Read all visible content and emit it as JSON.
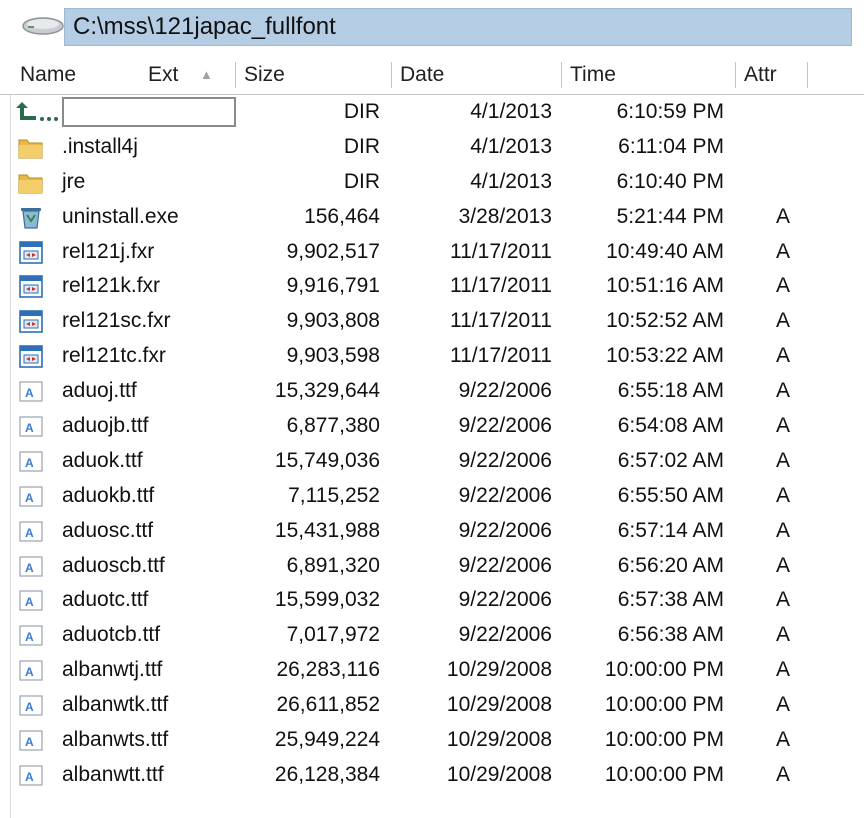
{
  "path": {
    "icon": "drive-icon",
    "value": "C:\\mss\\121japac_fullfont"
  },
  "columns": {
    "name": "Name",
    "ext": "Ext",
    "size": "Size",
    "date": "Date",
    "time": "Time",
    "attr": "Attr",
    "sort_indicator": "▲"
  },
  "up_row": {
    "icon": "up-folder-icon",
    "label": "",
    "size": "DIR",
    "date": "4/1/2013",
    "time": "6:10:59 PM",
    "attr": ""
  },
  "files": [
    {
      "icon": "folder-icon",
      "name": ".install4j",
      "size": "DIR",
      "date": "4/1/2013",
      "time": "6:11:04 PM",
      "attr": ""
    },
    {
      "icon": "folder-icon",
      "name": "jre",
      "size": "DIR",
      "date": "4/1/2013",
      "time": "6:10:40 PM",
      "attr": ""
    },
    {
      "icon": "uninstall-icon",
      "name": "uninstall.exe",
      "size": "156,464",
      "date": "3/28/2013",
      "time": "5:21:44 PM",
      "attr": "A"
    },
    {
      "icon": "fxr-file-icon",
      "name": "rel121j.fxr",
      "size": "9,902,517",
      "date": "11/17/2011",
      "time": "10:49:40 AM",
      "attr": "A"
    },
    {
      "icon": "fxr-file-icon",
      "name": "rel121k.fxr",
      "size": "9,916,791",
      "date": "11/17/2011",
      "time": "10:51:16 AM",
      "attr": "A"
    },
    {
      "icon": "fxr-file-icon",
      "name": "rel121sc.fxr",
      "size": "9,903,808",
      "date": "11/17/2011",
      "time": "10:52:52 AM",
      "attr": "A"
    },
    {
      "icon": "fxr-file-icon",
      "name": "rel121tc.fxr",
      "size": "9,903,598",
      "date": "11/17/2011",
      "time": "10:53:22 AM",
      "attr": "A"
    },
    {
      "icon": "font-file-icon",
      "name": "aduoj.ttf",
      "size": "15,329,644",
      "date": "9/22/2006",
      "time": "6:55:18 AM",
      "attr": "A"
    },
    {
      "icon": "font-file-icon",
      "name": "aduojb.ttf",
      "size": "6,877,380",
      "date": "9/22/2006",
      "time": "6:54:08 AM",
      "attr": "A"
    },
    {
      "icon": "font-file-icon",
      "name": "aduok.ttf",
      "size": "15,749,036",
      "date": "9/22/2006",
      "time": "6:57:02 AM",
      "attr": "A"
    },
    {
      "icon": "font-file-icon",
      "name": "aduokb.ttf",
      "size": "7,115,252",
      "date": "9/22/2006",
      "time": "6:55:50 AM",
      "attr": "A"
    },
    {
      "icon": "font-file-icon",
      "name": "aduosc.ttf",
      "size": "15,431,988",
      "date": "9/22/2006",
      "time": "6:57:14 AM",
      "attr": "A"
    },
    {
      "icon": "font-file-icon",
      "name": "aduoscb.ttf",
      "size": "6,891,320",
      "date": "9/22/2006",
      "time": "6:56:20 AM",
      "attr": "A"
    },
    {
      "icon": "font-file-icon",
      "name": "aduotc.ttf",
      "size": "15,599,032",
      "date": "9/22/2006",
      "time": "6:57:38 AM",
      "attr": "A"
    },
    {
      "icon": "font-file-icon",
      "name": "aduotcb.ttf",
      "size": "7,017,972",
      "date": "9/22/2006",
      "time": "6:56:38 AM",
      "attr": "A"
    },
    {
      "icon": "font-file-icon",
      "name": "albanwtj.ttf",
      "size": "26,283,116",
      "date": "10/29/2008",
      "time": "10:00:00 PM",
      "attr": "A"
    },
    {
      "icon": "font-file-icon",
      "name": "albanwtk.ttf",
      "size": "26,611,852",
      "date": "10/29/2008",
      "time": "10:00:00 PM",
      "attr": "A"
    },
    {
      "icon": "font-file-icon",
      "name": "albanwts.ttf",
      "size": "25,949,224",
      "date": "10/29/2008",
      "time": "10:00:00 PM",
      "attr": "A"
    },
    {
      "icon": "font-file-icon",
      "name": "albanwtt.ttf",
      "size": "26,128,384",
      "date": "10/29/2008",
      "time": "10:00:00 PM",
      "attr": "A"
    }
  ],
  "colors": {
    "path_bg": "#b4cde4",
    "folder": "#e8b94a",
    "fxr_icon": "#2f6fb5",
    "font_icon": "#3b7bd0"
  }
}
